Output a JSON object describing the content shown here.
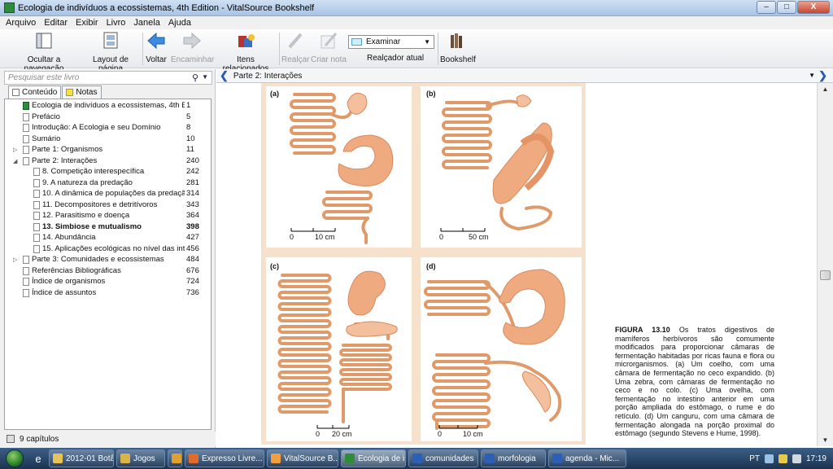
{
  "window": {
    "title": "Ecologia de indivíduos a ecossistemas, 4th Edition - VitalSource Bookshelf",
    "min": "–",
    "max": "□",
    "close": "X"
  },
  "menu": [
    "Arquivo",
    "Editar",
    "Exibir",
    "Livro",
    "Janela",
    "Ajuda"
  ],
  "toolbar": {
    "hide_nav": "Ocultar a navegação",
    "page_layout": "Layout de página",
    "back": "Voltar",
    "forward": "Encaminhar",
    "related": "Itens relacionados",
    "highlight": "Realçar",
    "create_note": "Criar nota",
    "highlighter_value": "Examinar",
    "highlighter_label": "Realçador atual",
    "bookshelf": "Bookshelf"
  },
  "sidebar": {
    "search_placeholder": "Pesquisar este livro",
    "tabs": [
      "Conteúdo",
      "Notas"
    ],
    "status": "9 capítulos",
    "toc": [
      {
        "label": "Ecologia de indivíduos a ecossistemas, 4th Ed...",
        "page": "1",
        "level": 0,
        "expander": "",
        "book": true
      },
      {
        "label": "Prefácio",
        "page": "5",
        "level": 0,
        "expander": ""
      },
      {
        "label": "Introdução: A Ecologia e seu Domínio",
        "page": "8",
        "level": 0,
        "expander": ""
      },
      {
        "label": "Sumário",
        "page": "10",
        "level": 0,
        "expander": ""
      },
      {
        "label": "Parte 1: Organismos",
        "page": "11",
        "level": 0,
        "expander": "▷"
      },
      {
        "label": "Parte 2: Interações",
        "page": "240",
        "level": 0,
        "expander": "◢"
      },
      {
        "label": "8. Competição interespecífica",
        "page": "242",
        "level": 1,
        "expander": ""
      },
      {
        "label": "9. A natureza da predação",
        "page": "281",
        "level": 1,
        "expander": ""
      },
      {
        "label": "10. A dinâmica de populações da predação",
        "page": "314",
        "level": 1,
        "expander": ""
      },
      {
        "label": "11. Decompositores e detritívoros",
        "page": "343",
        "level": 1,
        "expander": ""
      },
      {
        "label": "12. Parasitismo e doença",
        "page": "364",
        "level": 1,
        "expander": ""
      },
      {
        "label": "13. Simbiose e mutualismo",
        "page": "398",
        "level": 1,
        "expander": "",
        "selected": true
      },
      {
        "label": "14. Abundância",
        "page": "427",
        "level": 1,
        "expander": ""
      },
      {
        "label": "15. Aplicações ecológicas no nível das int...",
        "page": "456",
        "level": 1,
        "expander": ""
      },
      {
        "label": "Parte 3: Comunidades e ecossistemas",
        "page": "484",
        "level": 0,
        "expander": "▷"
      },
      {
        "label": "Referências Bibliográficas",
        "page": "676",
        "level": 0,
        "expander": ""
      },
      {
        "label": "Índice de organismos",
        "page": "724",
        "level": 0,
        "expander": ""
      },
      {
        "label": "Índice de assuntos",
        "page": "736",
        "level": 0,
        "expander": ""
      }
    ]
  },
  "content": {
    "breadcrumb": "Parte 2: Interações",
    "figure": {
      "panels": [
        {
          "label": "(a)",
          "scale_zero": "0",
          "scale_end": "10 cm"
        },
        {
          "label": "(b)",
          "scale_zero": "0",
          "scale_end": "50 cm"
        },
        {
          "label": "(c)",
          "scale_zero": "0",
          "scale_end": "20 cm"
        },
        {
          "label": "(d)",
          "scale_zero": "0",
          "scale_end": "10 cm"
        }
      ],
      "caption_title": "FIGURA 13.10",
      "caption_text": "Os tratos digestivos de mamíferos herbívoros são comumente modificados para proporcionar câmaras de fermentação habitadas por ricas fauna e flora ou microrganismos. (a) Um coelho, com uma câmara de fermentação no ceco expandido. (b) Uma zebra, com câmaras de fermentação no ceco e no colo. (c) Uma ovelha, com fermentação no intestino anterior em uma porção ampliada do estômago, o rume e do retículo. (d) Um canguru, com uma câmara de fermentação alongada na porção proximal do estômago (segundo Stevens e Hume, 1998)."
    }
  },
  "taskbar": {
    "tasks": [
      {
        "label": "2012-01 Botâ...",
        "color": "#e8c25a"
      },
      {
        "label": "Jogos",
        "color": "#d9b44a"
      },
      {
        "label": "",
        "color": "#e0a030"
      },
      {
        "label": "Expresso Livre...",
        "color": "#e06b2a"
      },
      {
        "label": "VitalSource B...",
        "color": "#f0a040"
      },
      {
        "label": "Ecologia de i...",
        "color": "#2e8b3a",
        "active": true
      },
      {
        "label": "comunidades",
        "color": "#2b5fb8"
      },
      {
        "label": "morfologia",
        "color": "#2b5fb8"
      },
      {
        "label": "agenda - Mic...",
        "color": "#2b5fb8"
      }
    ],
    "lang": "PT",
    "clock": "17:19"
  },
  "colors": {
    "gut": "#efb28c",
    "gut_stroke": "#d98a5c",
    "figure_bg": "#f6e1cc",
    "accent": "#2a5db0"
  }
}
